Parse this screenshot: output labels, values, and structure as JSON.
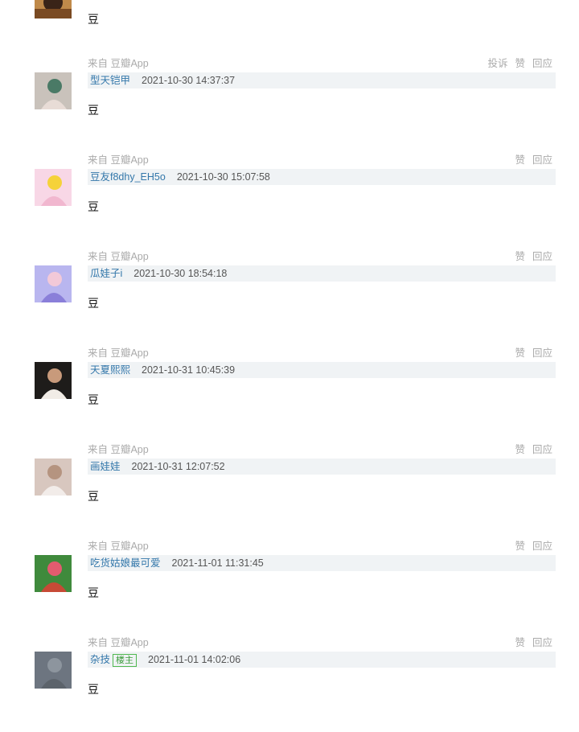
{
  "top_item": {
    "content": "豆"
  },
  "comments": [
    {
      "source": "来自 豆瓣App",
      "actions": [
        "投诉",
        "赞",
        "回应"
      ],
      "user": "型天铠甲",
      "op_badge": "",
      "time": "2021-10-30 14:37:37",
      "content": "豆",
      "avatar_colors": [
        "#c9c2bb",
        "#4a7a66",
        "#e8dcd6"
      ]
    },
    {
      "source": "来自 豆瓣App",
      "actions": [
        "赞",
        "回应"
      ],
      "user": "豆友f8dhy_EH5o",
      "op_badge": "",
      "time": "2021-10-30 15:07:58",
      "content": "豆",
      "avatar_colors": [
        "#f8d7e6",
        "#f5d23a",
        "#f1b7cf"
      ]
    },
    {
      "source": "来自 豆瓣App",
      "actions": [
        "赞",
        "回应"
      ],
      "user": "瓜娃子i",
      "op_badge": "",
      "time": "2021-10-30 18:54:18",
      "content": "豆",
      "avatar_colors": [
        "#b9b6ef",
        "#f2c9d8",
        "#8a7fd9"
      ]
    },
    {
      "source": "来自 豆瓣App",
      "actions": [
        "赞",
        "回应"
      ],
      "user": "天夏熙熙",
      "op_badge": "",
      "time": "2021-10-31 10:45:39",
      "content": "豆",
      "avatar_colors": [
        "#1e1c1a",
        "#c89a7b",
        "#f1ece6"
      ]
    },
    {
      "source": "来自 豆瓣App",
      "actions": [
        "赞",
        "回应"
      ],
      "user": "画娃娃",
      "op_badge": "",
      "time": "2021-10-31 12:07:52",
      "content": "豆",
      "avatar_colors": [
        "#d8c7bf",
        "#b59480",
        "#f2ece9"
      ]
    },
    {
      "source": "来自 豆瓣App",
      "actions": [
        "赞",
        "回应"
      ],
      "user": "吃货姑娘最可爱",
      "op_badge": "",
      "time": "2021-11-01 11:31:45",
      "content": "豆",
      "avatar_colors": [
        "#3f8a3c",
        "#e25b6f",
        "#c74a36"
      ]
    },
    {
      "source": "来自 豆瓣App",
      "actions": [
        "赞",
        "回应"
      ],
      "user": "杂技",
      "op_badge": "楼主",
      "time": "2021-11-01 14:02:06",
      "content": "豆",
      "avatar_colors": [
        "#6d7580",
        "#8d959e",
        "#5c636b"
      ]
    }
  ]
}
